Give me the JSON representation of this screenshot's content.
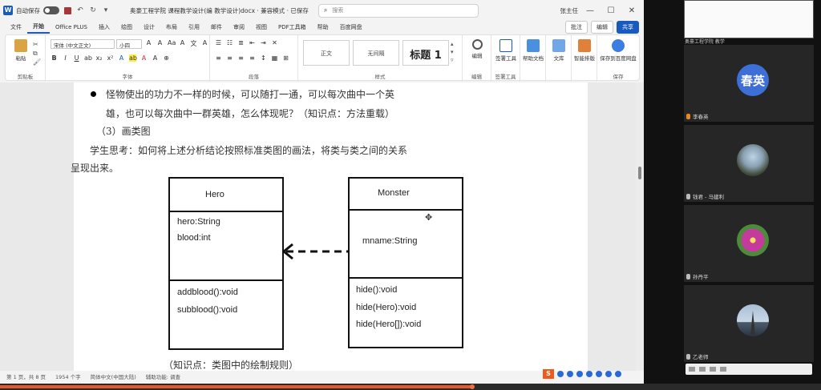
{
  "titlebar": {
    "autosave": "自动保存",
    "doc_title": "奥豪工程学院 课程教学设计(编 教学设计)docx · 兼容模式 · 已保存",
    "search_placeholder": "搜索",
    "user": "张主任"
  },
  "tabs": [
    "文件",
    "开始",
    "Office PLUS",
    "插入",
    "绘图",
    "设计",
    "布局",
    "引用",
    "邮件",
    "审阅",
    "视图",
    "PDF工具箱",
    "帮助",
    "百度网盘"
  ],
  "active_tab": "开始",
  "actions": {
    "comment": "批注",
    "edit": "编辑",
    "share": "共享"
  },
  "ribbon": {
    "paste": "粘贴",
    "clipboard_label": "剪贴板",
    "font_name": "宋体 (中文正文)",
    "font_size": "小四",
    "font_label": "字体",
    "paragraph_label": "段落",
    "styles": [
      "正文",
      "无间隔",
      "标题 1"
    ],
    "styles_label": "样式",
    "find": "编辑",
    "editing_label": "编辑",
    "sign": "签署工具",
    "sign_label": "签署工具",
    "help": "帮助文档",
    "doc": "文库",
    "combine": "智能排版",
    "save_cloud": "保存到百度网盘",
    "cloud_label": "保存"
  },
  "doc": {
    "line1": "怪物使出的功力不一样的时候，可以随打一通，可以每次曲中一个英",
    "line2": "雄，也可以每次曲中一群英雄，怎么体现呢？（知识点：方法重载）",
    "line3": "（3）画类图",
    "line4": "学生思考：如何将上述分析结论按照标准类图的画法，将类与类之间的关系",
    "line5": "呈现出来。",
    "line_bottom": "（知识点：类图中的绘制规则）"
  },
  "uml": {
    "hero": {
      "name": "Hero",
      "attr1": "hero:String",
      "attr2": "blood:int",
      "op1": "addblood():void",
      "op2": "subblood():void"
    },
    "monster": {
      "name": "Monster",
      "attr1": "mname:String",
      "op1": "hide():void",
      "op2": "hide(Hero):void",
      "op3": "hide(Hero[]):void"
    }
  },
  "statusbar": {
    "page": "第 1 页，共 8 页",
    "words": "1954 个字",
    "lang": "简体中文(中国大陆)",
    "access": "辅助功能: 调查"
  },
  "ime": "S",
  "progress": {
    "fraction": 0.575
  },
  "participants": [
    {
      "name": "李春英",
      "avatar_text": "春英",
      "type": "text"
    },
    {
      "name": "钱君 - 马建利",
      "type": "photo1"
    },
    {
      "name": "孙丹平",
      "type": "flower"
    },
    {
      "name": "乙老师",
      "type": "photo3"
    }
  ],
  "top_thumb_label": "奥豪工程学院 教学"
}
